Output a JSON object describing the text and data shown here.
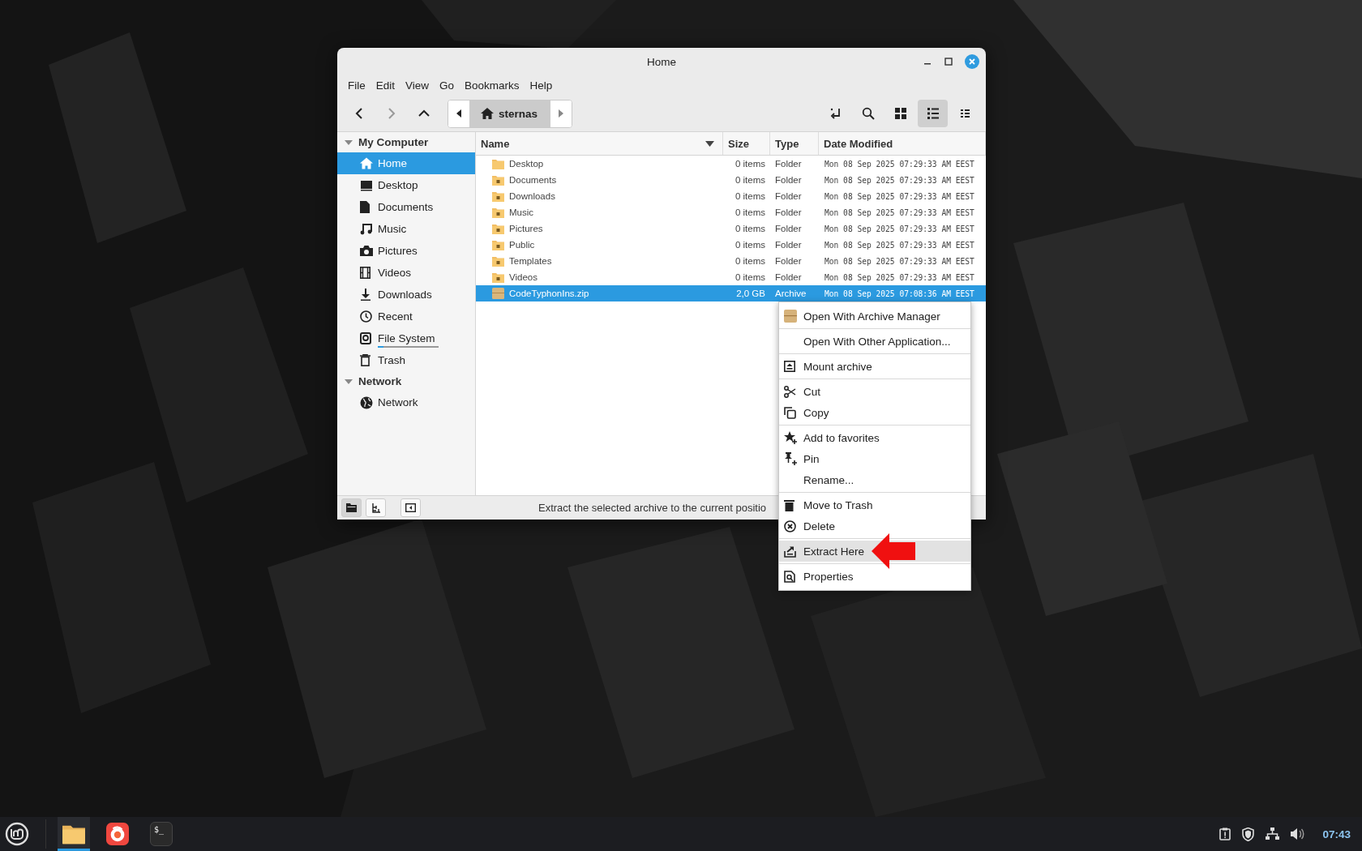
{
  "window": {
    "title": "Home"
  },
  "menu_bar": [
    "File",
    "Edit",
    "View",
    "Go",
    "Bookmarks",
    "Help"
  ],
  "toolbar": {
    "breadcrumb": {
      "label": "sternas",
      "selected": true
    },
    "view_buttons": [
      {
        "selected": false
      },
      {
        "selected": true
      },
      {
        "selected": false
      }
    ]
  },
  "sidebar": {
    "sections": [
      {
        "title": "My Computer",
        "expanded": true,
        "items": [
          {
            "label": "Home",
            "selected": true
          },
          {
            "label": "Desktop",
            "selected": false
          },
          {
            "label": "Documents",
            "selected": false
          },
          {
            "label": "Music",
            "selected": false
          },
          {
            "label": "Pictures",
            "selected": false
          },
          {
            "label": "Videos",
            "selected": false
          },
          {
            "label": "Downloads",
            "selected": false
          },
          {
            "label": "Recent",
            "selected": false
          },
          {
            "label": "File System",
            "selected": false,
            "level": 0.1
          },
          {
            "label": "Trash",
            "selected": false
          }
        ]
      },
      {
        "title": "Network",
        "expanded": true,
        "items": [
          {
            "label": "Network",
            "selected": false
          }
        ]
      }
    ]
  },
  "file_list": {
    "columns": [
      {
        "label": "Name",
        "sorted": true
      },
      {
        "label": "Size",
        "sorted": false
      },
      {
        "label": "Type",
        "sorted": false
      },
      {
        "label": "Date Modified",
        "sorted": false
      }
    ],
    "rows": [
      {
        "name": "Desktop",
        "size": "0 items",
        "type": "Folder",
        "modified": "Mon 08 Sep 2025 07:29:33 AM EEST",
        "kind": "folder",
        "selected": false
      },
      {
        "name": "Documents",
        "size": "0 items",
        "type": "Folder",
        "modified": "Mon 08 Sep 2025 07:29:33 AM EEST",
        "kind": "folder",
        "selected": false
      },
      {
        "name": "Downloads",
        "size": "0 items",
        "type": "Folder",
        "modified": "Mon 08 Sep 2025 07:29:33 AM EEST",
        "kind": "folder",
        "selected": false
      },
      {
        "name": "Music",
        "size": "0 items",
        "type": "Folder",
        "modified": "Mon 08 Sep 2025 07:29:33 AM EEST",
        "kind": "folder",
        "selected": false
      },
      {
        "name": "Pictures",
        "size": "0 items",
        "type": "Folder",
        "modified": "Mon 08 Sep 2025 07:29:33 AM EEST",
        "kind": "folder",
        "selected": false
      },
      {
        "name": "Public",
        "size": "0 items",
        "type": "Folder",
        "modified": "Mon 08 Sep 2025 07:29:33 AM EEST",
        "kind": "folder",
        "selected": false
      },
      {
        "name": "Templates",
        "size": "0 items",
        "type": "Folder",
        "modified": "Mon 08 Sep 2025 07:29:33 AM EEST",
        "kind": "folder",
        "selected": false
      },
      {
        "name": "Videos",
        "size": "0 items",
        "type": "Folder",
        "modified": "Mon 08 Sep 2025 07:29:33 AM EEST",
        "kind": "folder",
        "selected": false
      },
      {
        "name": "CodeTyphonIns.zip",
        "size": "2,0 GB",
        "type": "Archive",
        "modified": "Mon 08 Sep 2025 07:08:36 AM EEST",
        "kind": "archive",
        "selected": true
      }
    ]
  },
  "status_bar": {
    "message": "Extract the selected archive to the current positio",
    "buttons": [
      {
        "selected": true
      },
      {
        "selected": false
      },
      {
        "selected": false
      }
    ]
  },
  "context_menu": {
    "groups": [
      {
        "items": [
          {
            "label": "Open With Archive Manager",
            "selected": false
          }
        ]
      },
      {
        "items": [
          {
            "label": "Open With Other Application...",
            "selected": false
          }
        ]
      },
      {
        "items": [
          {
            "label": "Mount archive",
            "selected": false
          }
        ]
      },
      {
        "items": [
          {
            "label": "Cut",
            "selected": false
          },
          {
            "label": "Copy",
            "selected": false
          }
        ]
      },
      {
        "items": [
          {
            "label": "Add to favorites",
            "selected": false
          },
          {
            "label": "Pin",
            "selected": false
          },
          {
            "label": "Rename...",
            "selected": false
          }
        ]
      },
      {
        "items": [
          {
            "label": "Move to Trash",
            "selected": false
          },
          {
            "label": "Delete",
            "selected": false
          }
        ]
      },
      {
        "items": [
          {
            "label": "Extract Here",
            "selected": true
          }
        ]
      },
      {
        "items": [
          {
            "label": "Properties",
            "selected": false
          }
        ]
      }
    ]
  },
  "taskbar": {
    "apps": [
      {
        "kind": "files",
        "active": true
      },
      {
        "kind": "browser",
        "active": false
      },
      {
        "kind": "terminal",
        "active": false,
        "glyph": "$_"
      }
    ],
    "clock": "07:43"
  }
}
